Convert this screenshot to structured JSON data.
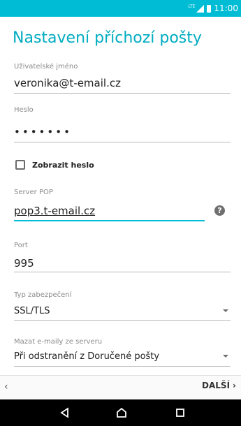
{
  "status_bar": {
    "network": "LTE",
    "time": "11:00"
  },
  "title": "Nastavení příchozí pošty",
  "fields": {
    "username": {
      "label": "Uživatelské jméno",
      "value": "veronika@t-email.cz"
    },
    "password": {
      "label": "Heslo",
      "value": "•••••••"
    },
    "show_password": {
      "label": "Zobrazit heslo",
      "checked": false
    },
    "server": {
      "label": "Server POP",
      "value": "pop3.t-email.cz"
    },
    "port": {
      "label": "Port",
      "value": "995"
    },
    "security": {
      "label": "Typ zabezpečení",
      "value": "SSL/TLS"
    },
    "delete": {
      "label": "Mazat e-maily ze serveru",
      "value": "Při odstranění z Doručené pošty"
    }
  },
  "buttons": {
    "next": "DALŠÍ"
  },
  "icons": {
    "help": "help-icon",
    "back": "back-chevron-icon",
    "next": "chevron-right-icon",
    "nav_back": "triangle-back-icon",
    "nav_home": "home-icon",
    "nav_recent": "recent-apps-icon"
  },
  "colors": {
    "accent": "#00bcd4",
    "title": "#00acc1"
  }
}
